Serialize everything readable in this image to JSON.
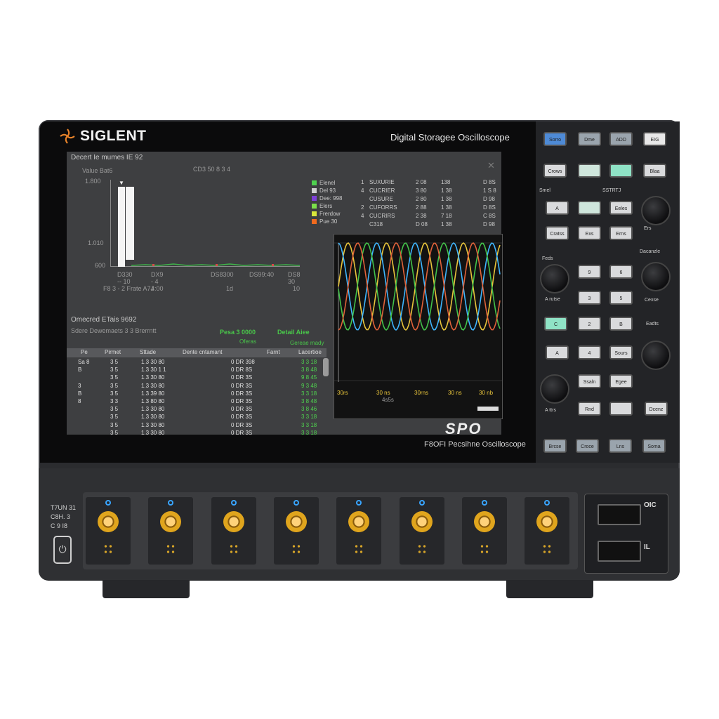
{
  "device": {
    "brand": "SIGLENT",
    "model_title": "Digital Storageе Oscilloscope",
    "logo_text": "SPO",
    "footer_title": "F8OFI Pecsihne Oscilloscope"
  },
  "histogram": {
    "title": "Decert Ie mumes IE 92",
    "subtitle_left": "Value Bat6",
    "subtitle_center": "CD3 50 8 3 4",
    "y_ticks": [
      "1.800",
      "1.010",
      "600"
    ],
    "x_labels": [
      "D330 -- 10",
      "DX9 - 4 4:00",
      "DS8300",
      "DS99:40",
      "DS8 30"
    ],
    "x_axis_label": "F8 3 - 2 Frate A7J",
    "x_axis_val1": "1d",
    "x_axis_val2": "10",
    "bars": [
      1.0,
      0.92
    ]
  },
  "legend": {
    "items": [
      {
        "label": "Elenel",
        "color": "#4fd24f"
      },
      {
        "label": "Del 93",
        "color": "#cfcfcf"
      },
      {
        "label": "Dee: 998",
        "color": "#7d3fd6"
      },
      {
        "label": "Elers",
        "color": "#7be04a"
      },
      {
        "label": "Frerdow",
        "color": "#d8e63a"
      },
      {
        "label": "Pue 30",
        "color": "#f06a1e"
      }
    ],
    "rows": [
      [
        "1",
        "SUXURIE",
        "2 08",
        "138",
        "D 8S"
      ],
      [
        "4",
        "CUCRIER",
        "3 80",
        "1 38",
        "1 S 8"
      ],
      [
        "",
        "CUSURE",
        "2 80",
        "1 38",
        "D 98"
      ],
      [
        "2",
        "CUFORRS",
        "2 88",
        "1 38",
        "D 8S"
      ],
      [
        "4",
        "CUCRIRS",
        "2 38",
        "7 18",
        "C 8S"
      ],
      [
        "",
        "C318",
        "D 08",
        "1 38",
        "D 98"
      ]
    ]
  },
  "waveform": {
    "footer_left": "30rs",
    "footer_labels": [
      "30 ns",
      "30rns",
      "30 ns",
      "30 nb"
    ],
    "footer_sub": "4s5s"
  },
  "table": {
    "title": "Omecred ETais 9692",
    "subtitle": "Sdere Dewemaets 3 3 Brerrntt",
    "green_1": "Pesa 3  0000",
    "green_2": "Detail Aiee",
    "green_3": "Oferas",
    "green_4": "Gereae mady",
    "headers": [
      "Pe",
      "Pirmet",
      "Sttade",
      "Dente cntamant",
      "Farnt",
      "Lacertioe"
    ],
    "rows": [
      {
        "a": "Sa 8",
        "b": "3  5",
        "c": "1.3 30 80",
        "d": "0 DR 398",
        "e": "3 3 18"
      },
      {
        "a": "B",
        "b": "3  5",
        "c": "1.3 30 1 1",
        "d": "0 DR 8S",
        "e": "3 8 48"
      },
      {
        "a": "",
        "b": "3  5",
        "c": "1.3 30 80",
        "d": "0 DR 3S",
        "e": "9 8 45"
      },
      {
        "a": "3",
        "b": "3  5",
        "c": "1.3 30 80",
        "d": "0 DR 3S",
        "e": "9 3 48"
      },
      {
        "a": "B",
        "b": "3  5",
        "c": "1.3 39 80",
        "d": "0 DR 3S",
        "e": "3 3 18"
      },
      {
        "a": "8",
        "b": "3  3",
        "c": "1.3 80 80",
        "d": "0 DR 3S",
        "e": "3 8 48"
      },
      {
        "a": "",
        "b": "3  5",
        "c": "1.3 30 80",
        "d": "0 DR 3S",
        "e": "3 8 46"
      },
      {
        "a": "",
        "b": "3  5",
        "c": "1.3 30 80",
        "d": "0 DR 3S",
        "e": "3 3 18"
      },
      {
        "a": "",
        "b": "3  5",
        "c": "1.3 30 80",
        "d": "0 DR 3S",
        "e": "3 3 18"
      },
      {
        "a": "",
        "b": "3  5",
        "c": "1.3 30 80",
        "d": "0 DR 3S",
        "e": "3 3 18"
      }
    ]
  },
  "controls": {
    "labels": {
      "top_left": "Smel",
      "top_right": "SSTRTJ",
      "r1": "Ers",
      "r2": "Dacanzle",
      "k1": "Feds",
      "k2": "A rutse",
      "k3": "Cexse",
      "k4": "Eadts",
      "k5": "A ttrs"
    },
    "buttons": [
      "Sorro",
      "Dme",
      "ADD",
      "EIG",
      "Crows",
      "",
      "",
      "Blaa",
      "A",
      "",
      "Eeles",
      "Cratss",
      "Exs",
      "Erns",
      "9",
      "6",
      "3",
      "5",
      "C",
      "2",
      "B",
      "A",
      "4",
      "Sours",
      "Ssaln",
      "Egee",
      "Rnd",
      "",
      "Dcenz",
      "Brcse",
      "Croce",
      "Lns",
      "Soma"
    ]
  },
  "front": {
    "left_labels": [
      "T7UN 31",
      "C8H. 3",
      "C 9 I8"
    ],
    "usb_labels": [
      "OIC",
      "IL"
    ],
    "channels": 8
  }
}
